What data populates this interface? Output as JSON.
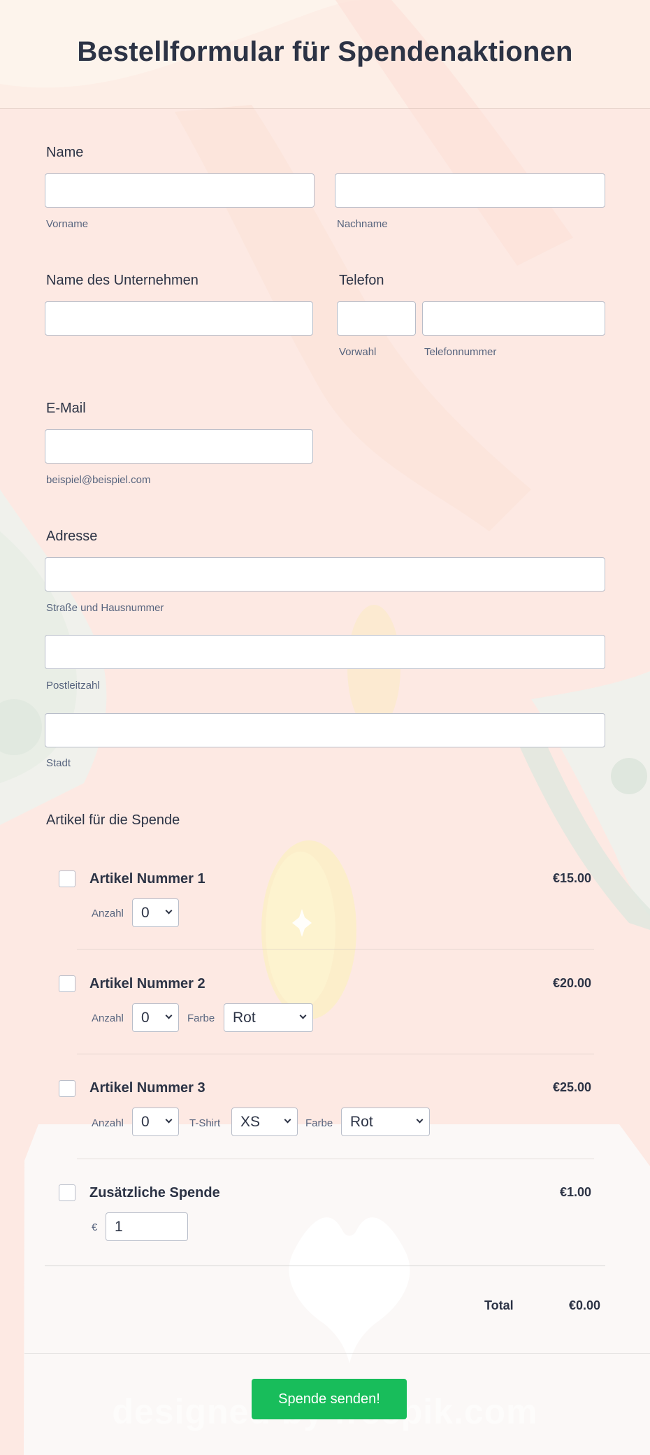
{
  "header": {
    "title": "Bestellformular für Spendenaktionen"
  },
  "name": {
    "label": "Name",
    "first": "Vorname",
    "last": "Nachname"
  },
  "company": {
    "label": "Name des Unternehmen"
  },
  "phone": {
    "label": "Telefon",
    "area": "Vorwahl",
    "number": "Telefonnummer"
  },
  "email": {
    "label": "E-Mail",
    "hint": "beispiel@beispiel.com"
  },
  "address": {
    "label": "Adresse",
    "street": "Straße und Hausnummer",
    "zip": "Postleitzahl",
    "city": "Stadt"
  },
  "products": {
    "label": "Artikel für die Spende",
    "items": [
      {
        "name": "Artikel Nummer 1",
        "price": "€15.00",
        "qty_label": "Anzahl",
        "qty": "0"
      },
      {
        "name": "Artikel Nummer 2",
        "price": "€20.00",
        "qty_label": "Anzahl",
        "qty": "0",
        "color_label": "Farbe",
        "color": "Rot"
      },
      {
        "name": "Artikel Nummer 3",
        "price": "€25.00",
        "qty_label": "Anzahl",
        "qty": "0",
        "size_label": "T-Shirt",
        "size": "XS",
        "color_label": "Farbe",
        "color": "Rot"
      },
      {
        "name": "Zusätzliche Spende",
        "price": "€1.00",
        "currency": "€",
        "amount": "1"
      }
    ],
    "total_label": "Total",
    "total_value": "€0.00"
  },
  "submit": {
    "label": "Spende senden!"
  },
  "watermark": "designed by freepik.com",
  "colors": {
    "accent": "#18bd5b",
    "background": "#fde9e3",
    "text": "#2c3345"
  }
}
